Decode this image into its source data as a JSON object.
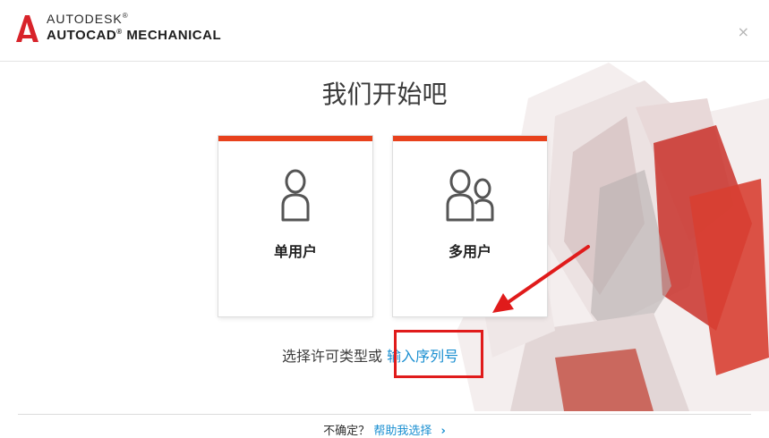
{
  "header": {
    "brand_top": "AUTODESK",
    "brand_main": "AUTOCAD",
    "brand_suffix": "MECHANICAL",
    "close_glyph": "×"
  },
  "title": "我们开始吧",
  "cards": {
    "single_label": "单用户",
    "single_icon": "single-user-icon",
    "multi_label": "多用户",
    "multi_icon": "multi-user-icon"
  },
  "license": {
    "prompt": "选择许可类型或",
    "serial_link": "输入序列号"
  },
  "footer": {
    "question": "不确定？",
    "help_link": "帮助我选择",
    "chevron": "›"
  },
  "colors": {
    "accent": "#e8411c",
    "link": "#1a8fd1",
    "highlight": "#e01b1b"
  }
}
